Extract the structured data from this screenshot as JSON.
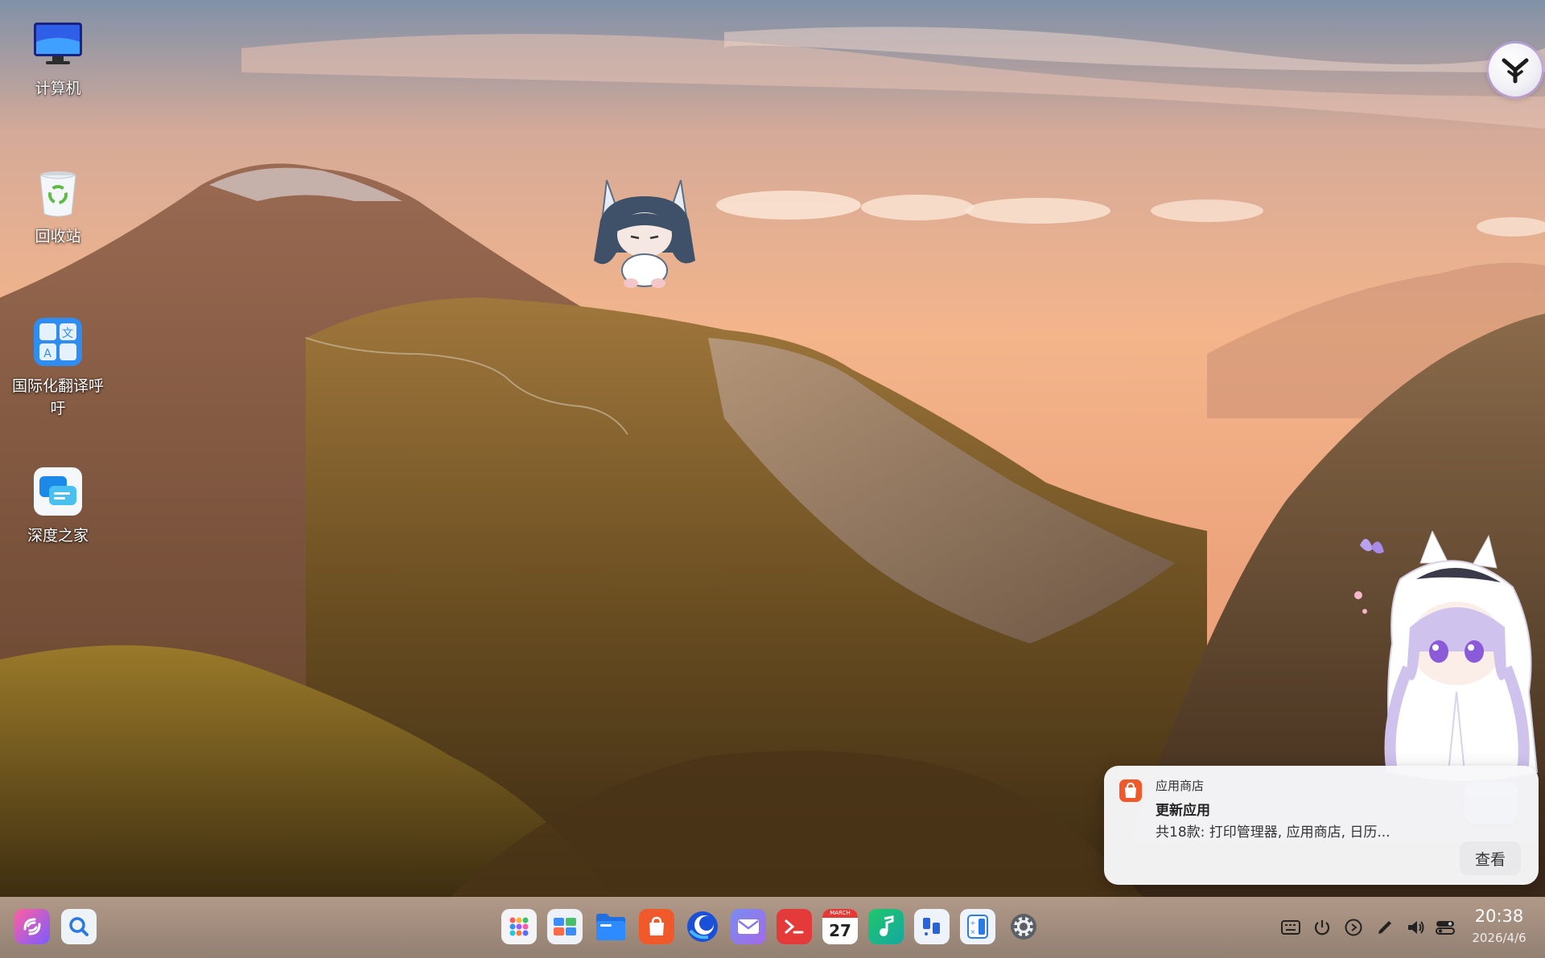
{
  "desktop": {
    "icons": [
      {
        "label": "计算机",
        "icon": "computer-monitor-icon"
      },
      {
        "label": "回收站",
        "icon": "recycle-bin-icon"
      },
      {
        "label": "国际化翻译呼吁",
        "icon": "translate-icon"
      },
      {
        "label": "深度之家",
        "icon": "deepin-home-chat-icon"
      }
    ]
  },
  "assistant": {
    "icon": "uos-ai-assistant-icon"
  },
  "notification": {
    "app_name": "应用商店",
    "title": "更新应用",
    "body": "共18款: 打印管理器, 应用商店, 日历...",
    "action_label": "查看",
    "app_icon": "app-store-bag-icon"
  },
  "taskbar": {
    "left": [
      {
        "name": "launcher",
        "icon": "launcher-swirl-icon"
      },
      {
        "name": "search",
        "icon": "search-icon"
      }
    ],
    "apps": [
      {
        "name": "app-grid",
        "icon": "grid-icon"
      },
      {
        "name": "multitask-view",
        "icon": "workspace-icon"
      },
      {
        "name": "file-manager",
        "icon": "folder-icon"
      },
      {
        "name": "app-store",
        "icon": "app-store-bag-icon"
      },
      {
        "name": "browser",
        "icon": "browser-icon"
      },
      {
        "name": "mail",
        "icon": "mail-icon"
      },
      {
        "name": "terminal",
        "icon": "terminal-icon"
      },
      {
        "name": "calendar",
        "icon": "calendar-icon",
        "month": "MARCH",
        "day": "27"
      },
      {
        "name": "music",
        "icon": "music-note-icon"
      },
      {
        "name": "quote-app",
        "icon": "quote-icon"
      },
      {
        "name": "calculator",
        "icon": "calculator-icon"
      },
      {
        "name": "settings",
        "icon": "gear-icon"
      }
    ],
    "tray": [
      {
        "name": "keyboard",
        "icon": "keyboard-icon"
      },
      {
        "name": "power",
        "icon": "power-icon"
      },
      {
        "name": "media",
        "icon": "play-circle-icon"
      },
      {
        "name": "pen",
        "icon": "pen-icon"
      },
      {
        "name": "volume",
        "icon": "volume-icon"
      },
      {
        "name": "control-center",
        "icon": "toggle-icon"
      }
    ],
    "clock": {
      "time": "20:38",
      "date": "2026/4/6"
    }
  },
  "colors": {
    "notification_bg": "#f8f8fa",
    "taskbar": "#9a8f84",
    "app_store": "#f05a2a"
  }
}
